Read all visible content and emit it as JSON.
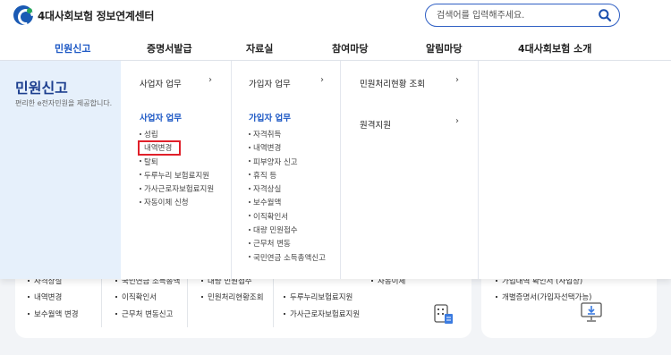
{
  "header": {
    "logo_text": "4대사회보험 정보연계센터",
    "search_placeholder": "검색어를 입력해주세요."
  },
  "gnb": [
    {
      "label": "민원신고",
      "active": true
    },
    {
      "label": "증명서발급"
    },
    {
      "label": "자료실"
    },
    {
      "label": "참여마당"
    },
    {
      "label": "알림마당"
    },
    {
      "label": "4대사회보험 소개"
    }
  ],
  "mega": {
    "title": "민원신고",
    "description": "편리한 e전자민원을 제공합니다.",
    "col1": {
      "head": "사업자 업무",
      "sub_head": "사업자 업무",
      "items": [
        "성립",
        "내역변경",
        "탈퇴",
        "두루누리 보험료지원",
        "가사근로자보험료지원",
        "자동이체 신청"
      ]
    },
    "col2": {
      "head": "가입자 업무",
      "sub_head": "가입자 업무",
      "items": [
        "자격취득",
        "내역변경",
        "피부양자 신고",
        "휴직 등",
        "자격상실",
        "보수월액",
        "이직확인서",
        "대량 민원접수",
        "근무처 변동",
        "국민연금 소득총액신고"
      ]
    },
    "col3": {
      "items": [
        "민원처리현황 조회",
        "원격지원"
      ]
    },
    "arrow": "›"
  },
  "background": {
    "row1": [
      "자격상실",
      "국민연금 소득총액",
      "대량 민원접수",
      "자동이체",
      "가입내역 확인서 (사업장)"
    ],
    "row2": [
      "내역변경",
      "이직확인서",
      "민원처리현황조회",
      "두루누리보험료지원",
      "개별증명서(가입자선택가능)"
    ],
    "row3": [
      "보수월액 변경",
      "근무처 변동신고",
      "가사근로자보험료지원"
    ]
  },
  "colors": {
    "accent": "#1a56c4",
    "highlight": "#e0202a",
    "side_bg": "#e6f0fb"
  }
}
